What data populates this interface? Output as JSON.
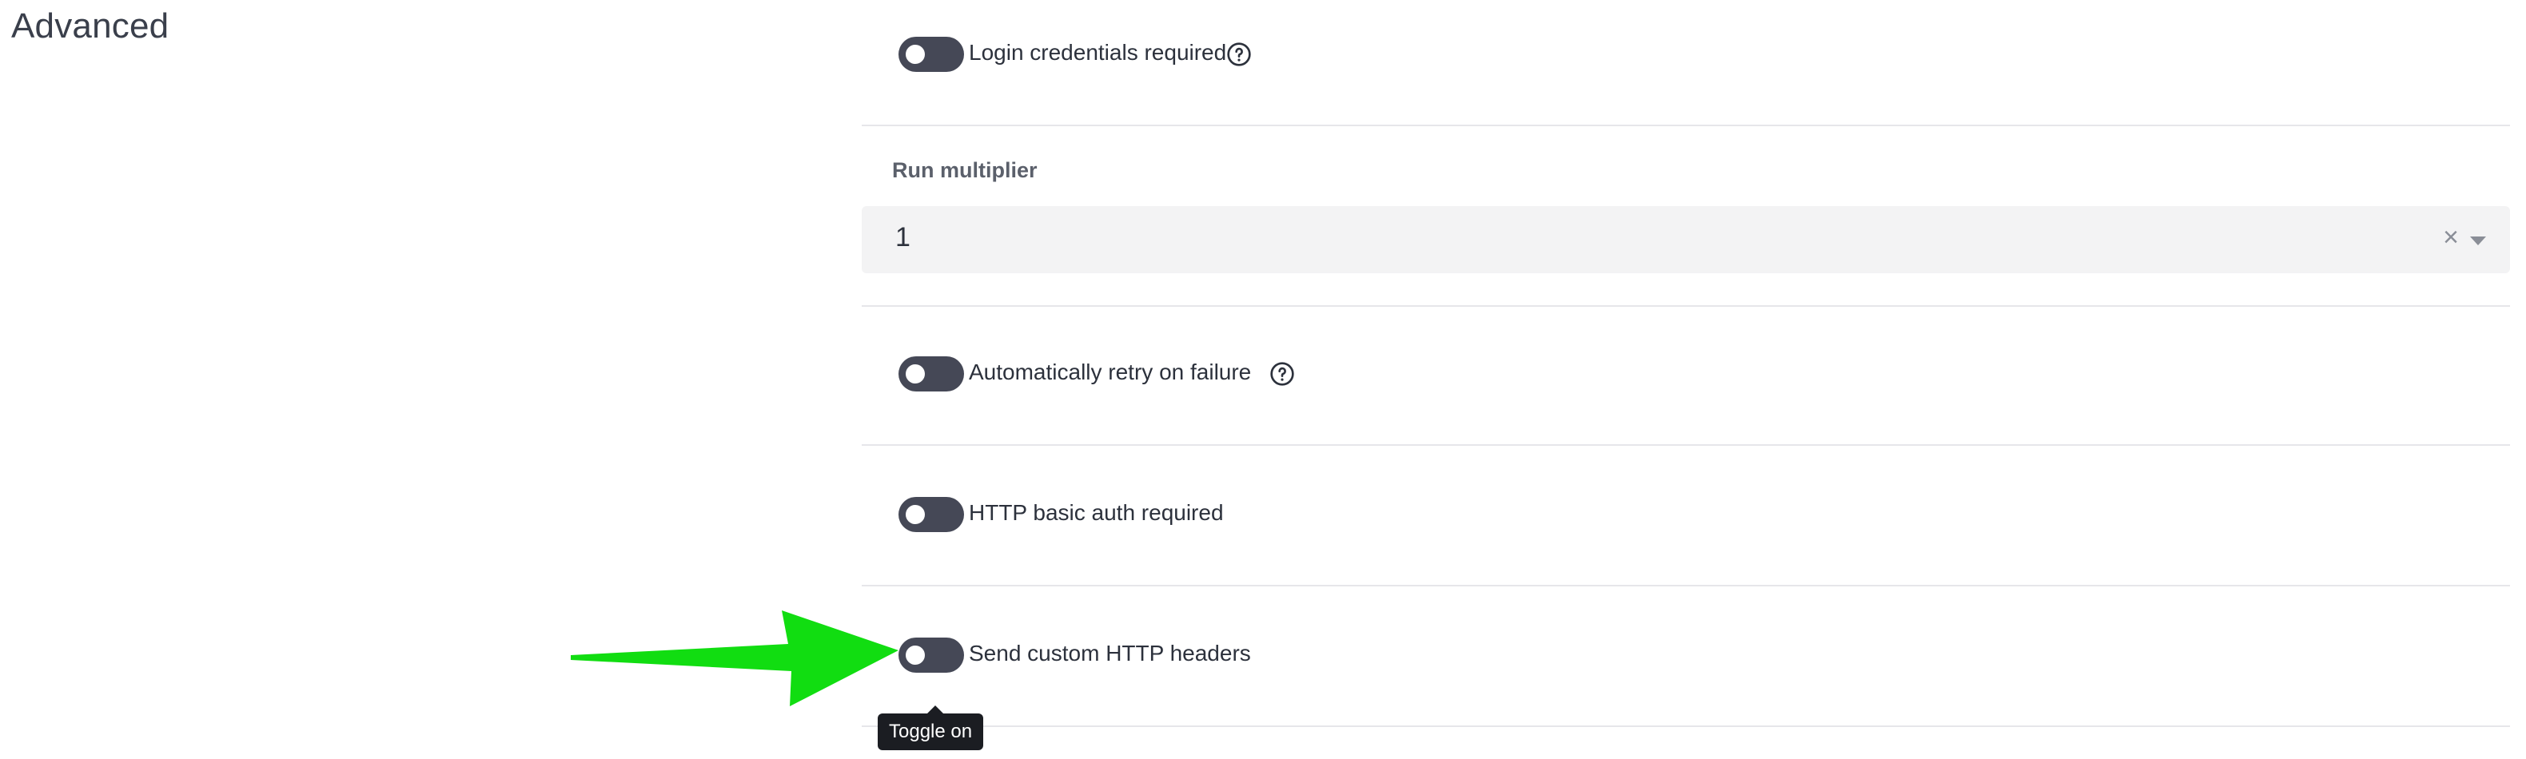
{
  "section": {
    "title": "Advanced"
  },
  "toggles": [
    {
      "label": "Login credentials required",
      "state": "off",
      "has_help": true
    },
    {
      "label": "Automatically retry on failure",
      "state": "off",
      "has_help": true
    },
    {
      "label": "HTTP basic auth required",
      "state": "off",
      "has_help": false
    },
    {
      "label": "Send custom HTTP headers",
      "state": "off",
      "has_help": false
    }
  ],
  "run_multiplier": {
    "label": "Run multiplier",
    "value": "1",
    "clear_icon": "close-icon",
    "dropdown_icon": "chevron-down-icon"
  },
  "tooltip": {
    "text": "Toggle on"
  },
  "annotation": {
    "arrow_icon": "green-arrow-icon",
    "color": "#11dd11"
  },
  "colors": {
    "toggle_off": "#454856",
    "divider": "#e6e6ea",
    "select_bg": "#f3f3f4",
    "tooltip_bg": "#1b1d22"
  }
}
